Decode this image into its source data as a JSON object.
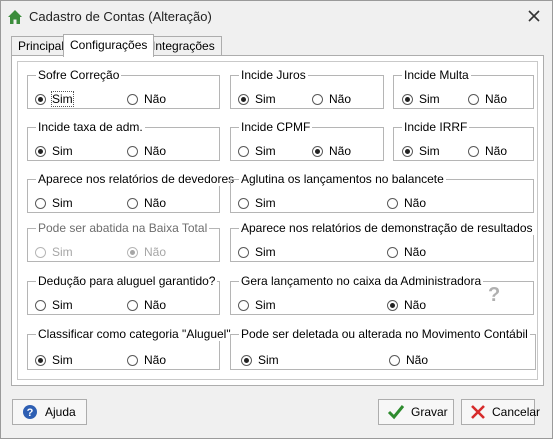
{
  "window": {
    "title": "Cadastro de Contas (Alteração)",
    "icon": "home-icon",
    "close_glyph": "×"
  },
  "tabs": [
    {
      "label": "Principal",
      "active": false
    },
    {
      "label": "Configurações",
      "active": true
    },
    {
      "label": "Integrações",
      "active": false
    }
  ],
  "options": {
    "sim": "Sim",
    "nao": "Não"
  },
  "groups": [
    {
      "label": "Sofre Correção",
      "selected": "sim",
      "enabled": true
    },
    {
      "label": "Incide Juros",
      "selected": "sim",
      "enabled": true
    },
    {
      "label": "Incide Multa",
      "selected": "sim",
      "enabled": true
    },
    {
      "label": "Incide taxa de adm.",
      "selected": "sim",
      "enabled": true
    },
    {
      "label": "Incide CPMF",
      "selected": "nao",
      "enabled": true
    },
    {
      "label": "Incide IRRF",
      "selected": "sim",
      "enabled": true
    },
    {
      "label": "Aparece nos relatórios de devedores",
      "selected": "none",
      "enabled": true
    },
    {
      "label": "Aglutina os lançamentos no balancete",
      "selected": "none",
      "enabled": true
    },
    {
      "label": "Pode ser abatida na Baixa Total",
      "selected": "nao",
      "enabled": false
    },
    {
      "label": "Aparece nos relatórios de demonstração de resultados",
      "selected": "none",
      "enabled": true
    },
    {
      "label": "Dedução para aluguel garantido?",
      "selected": "none",
      "enabled": true
    },
    {
      "label": "Gera lançamento no caixa da Administradora",
      "selected": "nao",
      "enabled": true
    },
    {
      "label": "Classificar como categoria \"Aluguel\"",
      "selected": "sim",
      "enabled": true
    },
    {
      "label": "Pode ser deletada ou alterada no Movimento Contábil",
      "selected": "sim",
      "enabled": true
    }
  ],
  "help_mark": "?",
  "buttons": {
    "help": {
      "label": "Ajuda",
      "icon": "help-icon"
    },
    "save": {
      "label": "Gravar",
      "icon": "checkmark-icon"
    },
    "cancel": {
      "label": "Cancelar",
      "icon": "cross-icon"
    }
  },
  "colors": {
    "save_check": "#2e8b2e",
    "cancel_x": "#d62b2b",
    "help_blue": "#2e5fb3",
    "home_green": "#3c8d3c"
  }
}
